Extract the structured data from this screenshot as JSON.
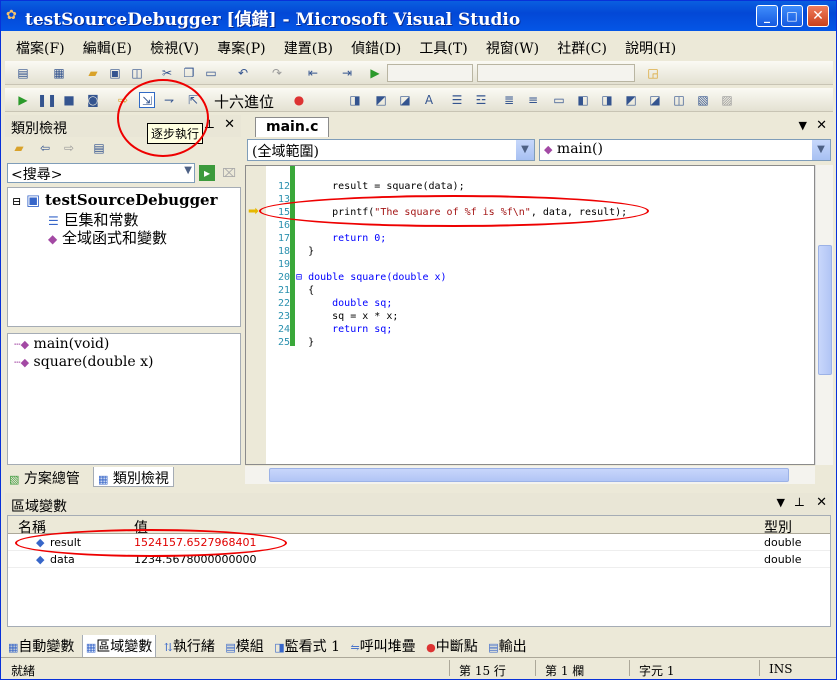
{
  "window": {
    "title": "testSourceDebugger [偵錯] - Microsoft Visual Studio",
    "minimize": "_",
    "maximize": "□",
    "close": "✕"
  },
  "menu": [
    "檔案(F)",
    "編輯(E)",
    "檢視(V)",
    "專案(P)",
    "建置(B)",
    "偵錯(D)",
    "工具(T)",
    "視窗(W)",
    "社群(C)",
    "說明(H)"
  ],
  "debug_toolbar": {
    "hex_label": "十六進位",
    "tooltip": "逐步執行"
  },
  "class_view": {
    "title": "類別檢視",
    "search_value": "<搜尋>",
    "tree": {
      "project": "testSourceDebugger",
      "children": [
        "巨集和常數",
        "全域函式和變數"
      ]
    },
    "members": [
      "main(void)",
      "square(double x)"
    ],
    "tabs": [
      "方案總管",
      "類別檢視"
    ]
  },
  "editor": {
    "tab": "main.c",
    "scope_combo": "(全域範圍)",
    "function_combo": "main()",
    "lines": [
      {
        "n": "12",
        "code": "    result = square(data);"
      },
      {
        "n": "13",
        "code": ""
      },
      {
        "n": "15",
        "code": "    printf(\"The square of %f is %f\\n\", data, result);"
      },
      {
        "n": "16",
        "code": ""
      },
      {
        "n": "17",
        "code": "    return 0;"
      },
      {
        "n": "18",
        "code": "}"
      },
      {
        "n": "19",
        "code": ""
      },
      {
        "n": "20",
        "code": "double square(double x)"
      },
      {
        "n": "21",
        "code": "{"
      },
      {
        "n": "22",
        "code": "    double sq;"
      },
      {
        "n": "23",
        "code": "    sq = x * x;"
      },
      {
        "n": "24",
        "code": "    return sq;"
      },
      {
        "n": "25",
        "code": "}"
      }
    ]
  },
  "locals": {
    "title": "區域變數",
    "columns": [
      "名稱",
      "值",
      "型別"
    ],
    "rows": [
      {
        "name": "result",
        "value": "1524157.6527968401",
        "type": "double",
        "changed": true
      },
      {
        "name": "data",
        "value": "1234.5678000000000",
        "type": "double",
        "changed": false
      }
    ]
  },
  "debug_tabs": [
    "自動變數",
    "區域變數",
    "執行緒",
    "模組",
    "監看式 1",
    "呼叫堆疊",
    "中斷點",
    "輸出"
  ],
  "status": {
    "ready": "就緒",
    "line": "第 15 行",
    "col": "第 1 欄",
    "char": "字元 1",
    "mode": "INS"
  },
  "colors": {
    "changed_value": "#e00000",
    "accent": "#0348d6",
    "annotation": "#e00000"
  }
}
